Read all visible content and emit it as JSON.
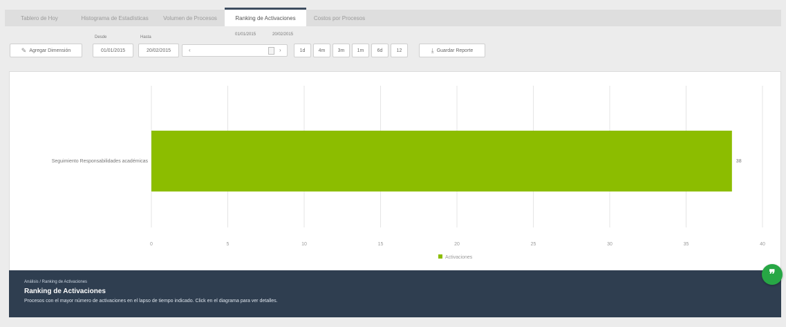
{
  "tabs": [
    {
      "label": "Tablero de Hoy",
      "active": false
    },
    {
      "label": "Histograma de Estadísticas",
      "active": false
    },
    {
      "label": "Volumen de Procesos",
      "active": false
    },
    {
      "label": "Ranking de Activaciones",
      "active": true
    },
    {
      "label": "Costos por Procesos",
      "active": false
    }
  ],
  "filters": {
    "add_dimension_label": "Agregar Dimensión",
    "desde_label": "Desde",
    "hasta_label": "Hasta",
    "desde_value": "01/01/2015",
    "hasta_value": "20/02/2015",
    "range_start": "01/01/2015",
    "range_end": "20/02/2015",
    "slider_left": "‹",
    "slider_right": "›",
    "time_buttons": [
      "1d",
      "4m",
      "3m",
      "1m",
      "6d",
      "12"
    ],
    "save_label": "Guardar Reporte"
  },
  "chart_data": {
    "type": "bar",
    "orientation": "horizontal",
    "categories": [
      "Seguimiento Responsabilidades académicas"
    ],
    "series": [
      {
        "name": "Activaciones",
        "values": [
          38
        ],
        "color": "#8cbd00"
      }
    ],
    "data_labels": [
      "38"
    ],
    "xlim": [
      0,
      40
    ],
    "x_ticks": [
      "0",
      "5",
      "10",
      "15",
      "20",
      "25",
      "30",
      "35",
      "40"
    ],
    "grid": true,
    "legend": "bottom"
  },
  "footer": {
    "breadcrumb": "Análisis / Ranking de Activaciones",
    "title": "Ranking de Activaciones",
    "description": "Procesos con el mayor número de activaciones en el lapso de tiempo indicado. Click en el diagrama para ver detalles."
  },
  "fab": {
    "label": "❞"
  }
}
